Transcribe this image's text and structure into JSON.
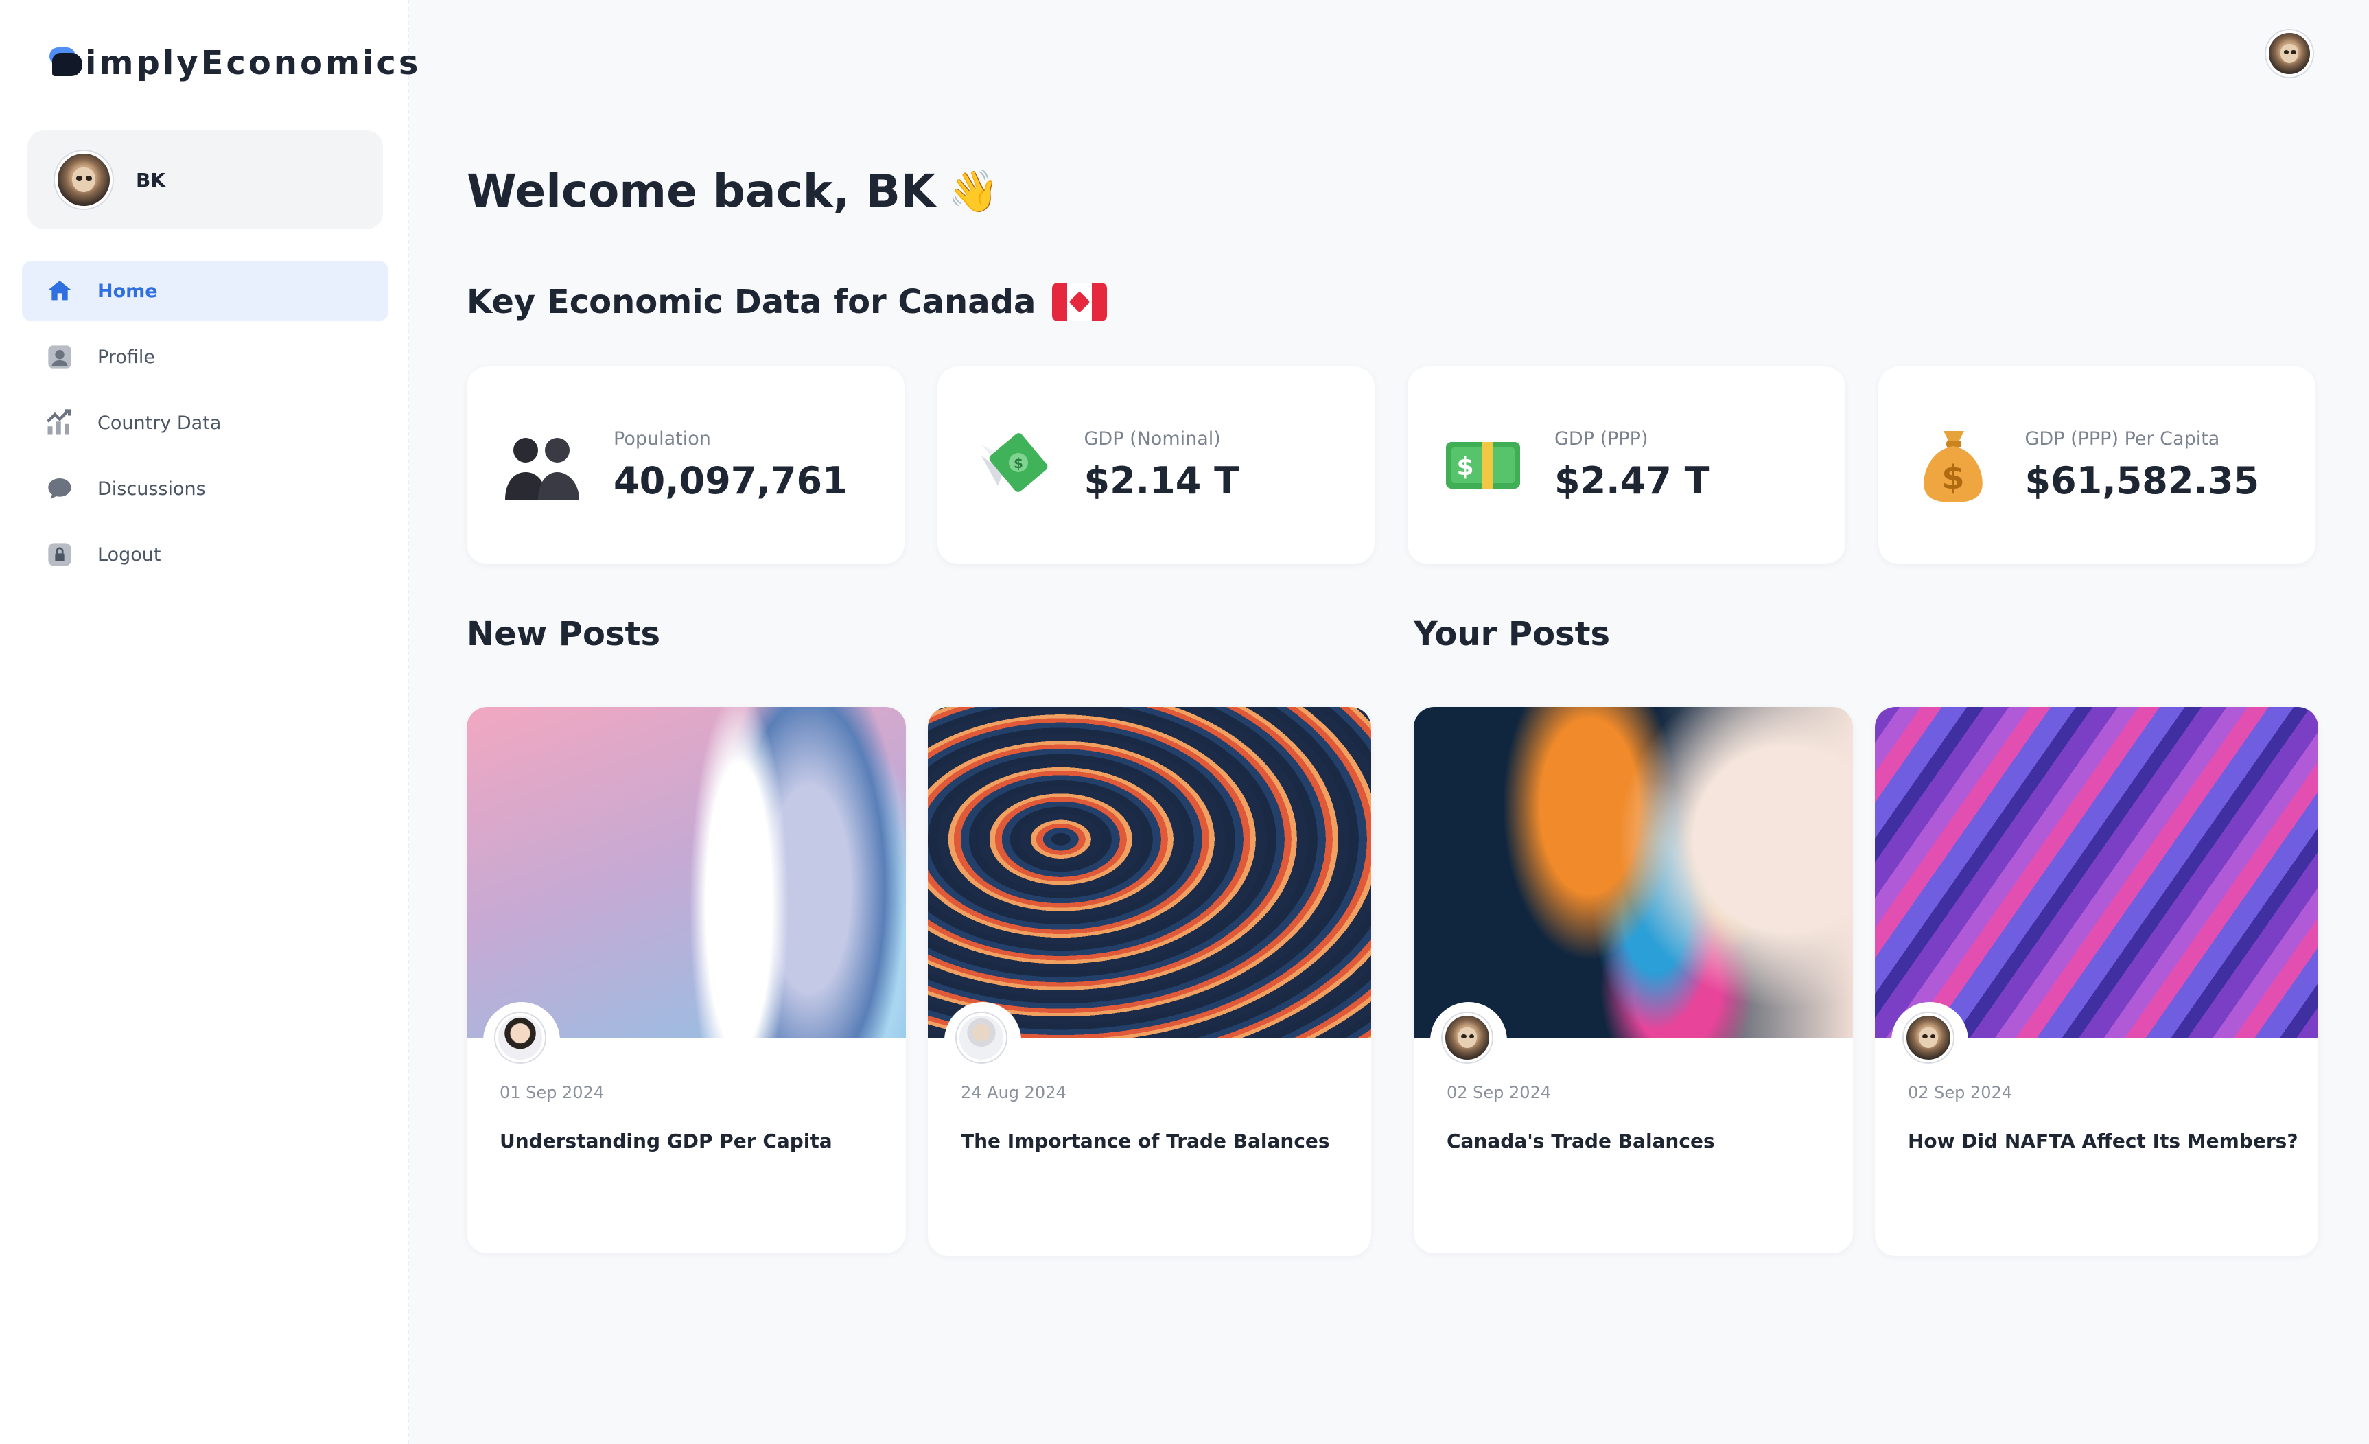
{
  "app": {
    "logo_text": "implyEconomics",
    "user_name": "BK"
  },
  "nav": [
    {
      "label": "Home",
      "icon": "home-icon"
    },
    {
      "label": "Profile",
      "icon": "profile-icon"
    },
    {
      "label": "Country Data",
      "icon": "chart-icon"
    },
    {
      "label": "Discussions",
      "icon": "chat-bubble-icon"
    },
    {
      "label": "Logout",
      "icon": "lock-icon"
    }
  ],
  "welcome": {
    "text": "Welcome back, BK",
    "emoji": "👋"
  },
  "key_data": {
    "title": "Key Economic Data for Canada",
    "stats": [
      {
        "label": "Population",
        "value": "40,097,761",
        "icon": "people-icon"
      },
      {
        "label": "GDP (Nominal)",
        "value": "$2.14 T",
        "icon": "money-with-wings-icon"
      },
      {
        "label": "GDP (PPP)",
        "value": "$2.47 T",
        "icon": "dollar-banknote-icon"
      },
      {
        "label": "GDP (PPP) Per Capita",
        "value": "$61,582.35",
        "icon": "money-bag-icon"
      }
    ]
  },
  "new_posts": {
    "title": "New Posts",
    "items": [
      {
        "date": "01 Sep 2024",
        "title": "Understanding GDP Per Capita"
      },
      {
        "date": "24 Aug 2024",
        "title": "The Importance of Trade Balances"
      }
    ]
  },
  "your_posts": {
    "title": "Your Posts",
    "items": [
      {
        "date": "02 Sep 2024",
        "title": "Canada's Trade Balances"
      },
      {
        "date": "02 Sep 2024",
        "title": "How Did NAFTA Affect Its Members?"
      }
    ]
  },
  "colors": {
    "accent": "#2f6fe0",
    "active_nav_bg": "#e8f0fe",
    "page_bg": "#f8f9fb"
  }
}
